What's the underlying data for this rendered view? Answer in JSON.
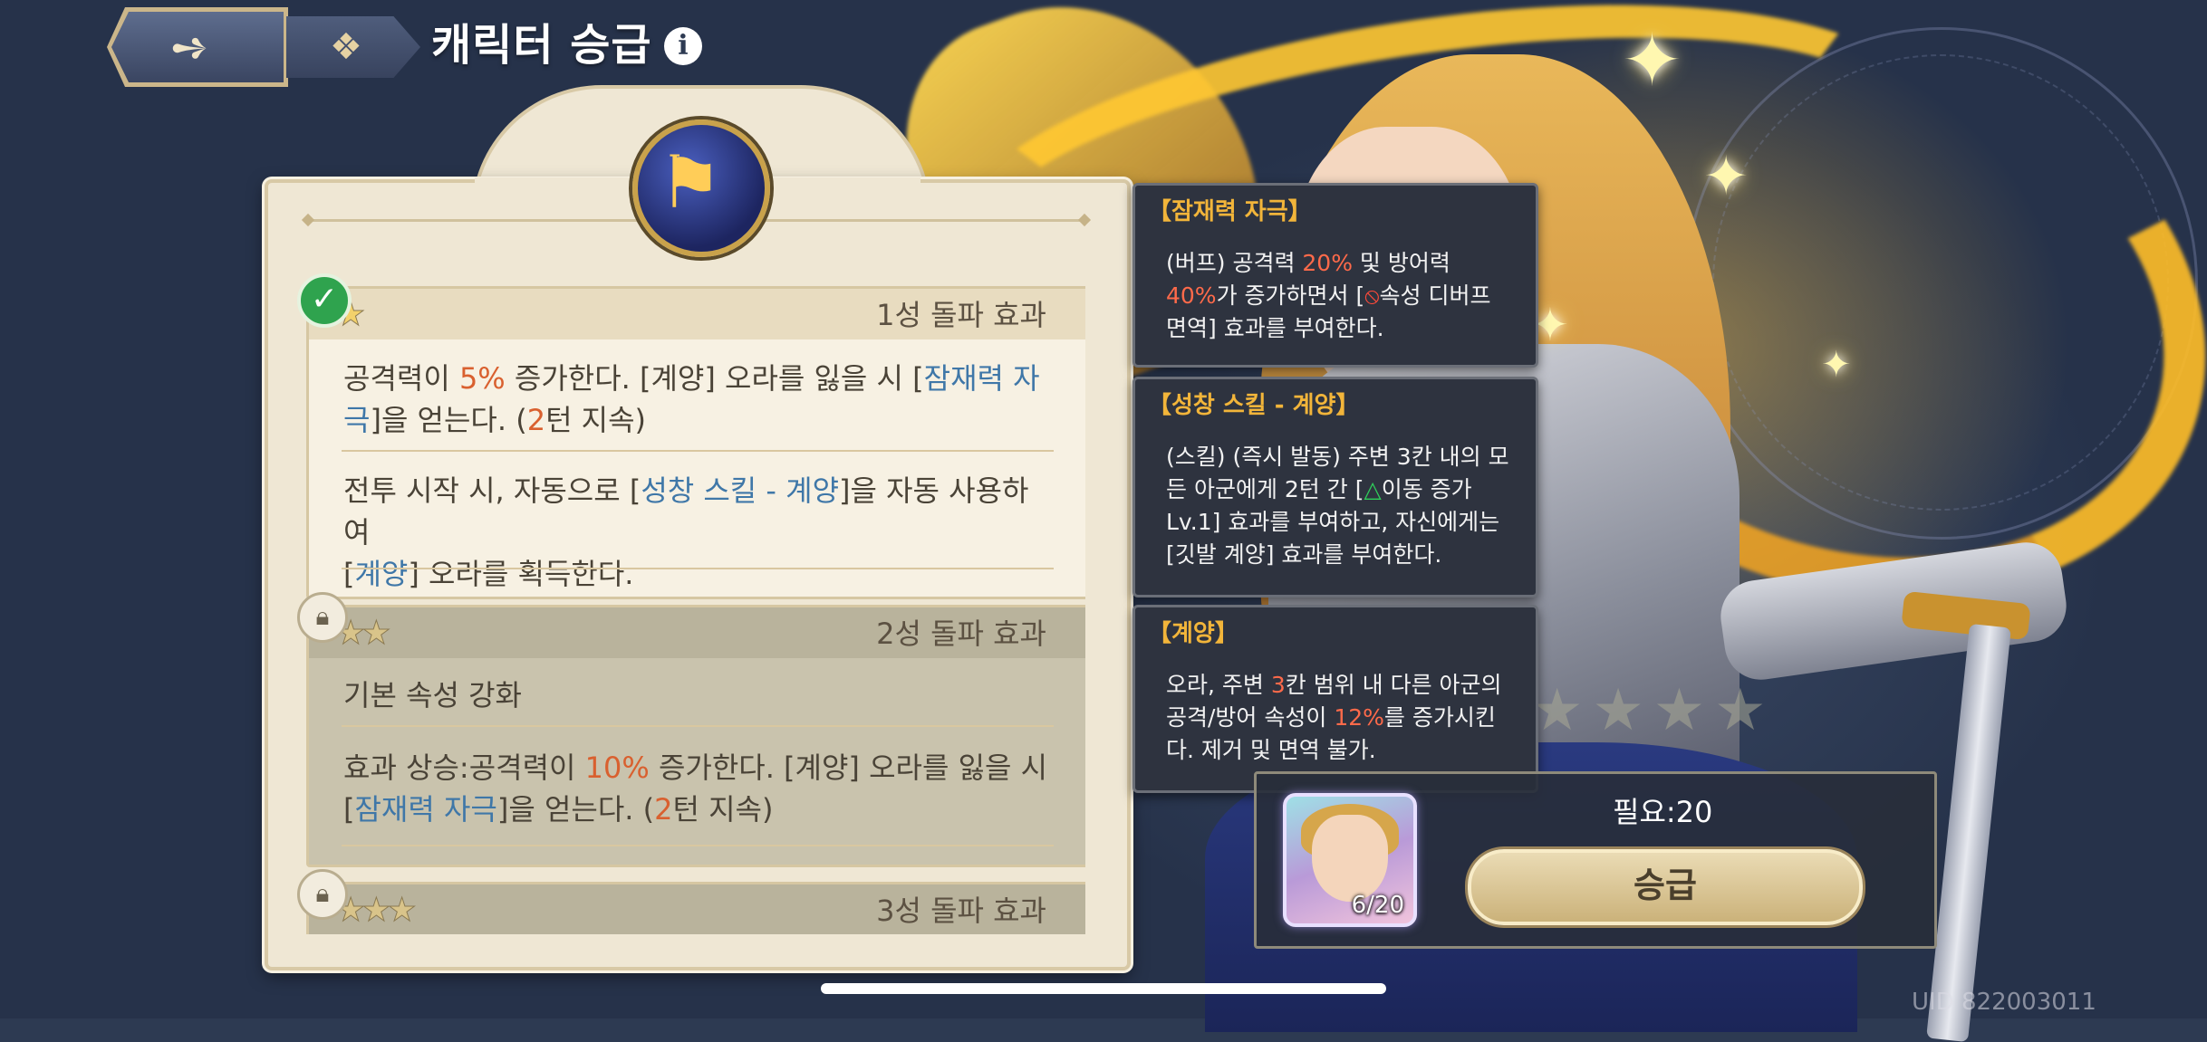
{
  "header": {
    "back_icon": "back-arrow-icon",
    "menu_icon": "grid-menu-icon",
    "title": "캐릭터 승급",
    "info_icon": "info-icon"
  },
  "panel": {
    "emblem_icon": "flag-emblem-icon",
    "sections": [
      {
        "title": "1성 돌파 효과",
        "status": "unlocked",
        "status_icon": "checkmark-icon",
        "stars": "★",
        "paragraph1": {
          "a": "공격력이 ",
          "b": "5%",
          "c": " 증가한다. [계양] 오라를 잃을 시 [",
          "d": "잠재력 자",
          "e": "극",
          "f": "]을 얻는다. (",
          "g": "2",
          "h": "턴 지속)"
        },
        "paragraph2": {
          "a": "전투 시작 시, 자동으로 [",
          "b": "성창 스킬 - 계양",
          "c": "]을 자동 사용하여",
          "d": "[",
          "e": "계양",
          "f": "] 오라를 획득한다."
        }
      },
      {
        "title": "2성 돌파 효과",
        "status": "locked",
        "status_icon": "lock-icon",
        "stars": "★★",
        "paragraph1": "기본 속성 강화",
        "paragraph2": {
          "a": "효과 상승:공격력이 ",
          "b": "10%",
          "c": " 증가한다. [계양] 오라를 잃을 시",
          "d": "[",
          "e": "잠재력 자극",
          "f": "]을 얻는다. (",
          "g": "2",
          "h": "턴 지속)"
        }
      },
      {
        "title": "3성 돌파 효과",
        "status": "locked",
        "status_icon": "lock-icon",
        "stars": "★★★"
      }
    ]
  },
  "tooltips": [
    {
      "title": "【잠재력 자극】",
      "l1a": "(버프) 공격력 ",
      "l1b": "20%",
      "l1c": " 및 방어력",
      "l2a": "40%",
      "l2b": "가 증가하면서 [",
      "l2icon": "prohibit-icon",
      "l2c": "속성 디버프",
      "l3": "면역] 효과를 부여한다."
    },
    {
      "title": "【성창 스킬 - 계양】",
      "l1": "(스킬) (즉시 발동) 주변 3칸 내의 모",
      "l2a": "든 아군에게 2턴 간 [",
      "l2icon": "triangle-move-icon",
      "l2b": "이동 증가",
      "l3": "Lv.1] 효과를 부여하고, 자신에게는",
      "l4": "[깃발 계양] 효과를 부여한다."
    },
    {
      "title": "【계양】",
      "l1a": "오라, 주변 ",
      "l1b": "3",
      "l1c": "칸 범위 내 다른 아군의",
      "l2a": "공격/방어 속성이 ",
      "l2b": "12%",
      "l2c": "를 증가시킨",
      "l3": "다. 제거 및 면역 불가."
    }
  ],
  "upgrade": {
    "portrait_count": "6/20",
    "need_label": "필요:20",
    "button_label": "승급"
  },
  "uid_text": "UID 822003011",
  "colors": {
    "accent_red": "#d9602f",
    "accent_blue": "#3f77a8",
    "tooltip_title": "#f2b53a",
    "panel_bg": "#efe7d4"
  }
}
